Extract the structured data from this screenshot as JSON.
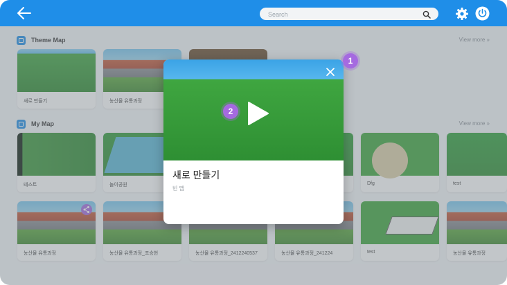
{
  "search": {
    "placeholder": "Search"
  },
  "theme_map": {
    "title": "Theme Map",
    "view_more": "View more »",
    "cards": [
      {
        "label": "새로 만들기",
        "thumb": "green-field"
      },
      {
        "label": "농산물 유통과정",
        "thumb": "farm"
      },
      {
        "label": "",
        "thumb": "dirt-field"
      }
    ]
  },
  "my_map": {
    "title": "My Map",
    "view_more": "View more »",
    "row1": [
      {
        "label": "테스트",
        "thumb": "dark-field"
      },
      {
        "label": "놀이공원",
        "thumb": "park"
      },
      {
        "label": "",
        "thumb": "green-field"
      },
      {
        "label": "",
        "thumb": "green-field"
      },
      {
        "label": "",
        "thumb": "green-field"
      },
      {
        "label": "Dfg",
        "thumb": "disc-field"
      },
      {
        "label": "test",
        "thumb": "green-field"
      }
    ],
    "row2": [
      {
        "label": "농산물 유통과정",
        "thumb": "farm"
      },
      {
        "label": "농산물 유통과정_조승현",
        "thumb": "farm"
      },
      {
        "label": "농산물 유통과정_2412240537",
        "thumb": "farm"
      },
      {
        "label": "농산물 유통과정_241224",
        "thumb": "farm"
      },
      {
        "label": "test",
        "thumb": "plane-field"
      },
      {
        "label": "농산물 유통과정",
        "thumb": "farm"
      }
    ]
  },
  "modal": {
    "title": "새로 만들기",
    "subtitle": "빈 맵"
  },
  "badges": {
    "one": "1",
    "two": "2"
  },
  "colors": {
    "topbar": "#1f8ee8",
    "badge": "#a56ae0",
    "accent": "#1f8ee8"
  },
  "icons": {
    "back": "arrow-left-icon",
    "search": "search-icon",
    "settings": "gear-icon",
    "power": "power-icon",
    "close": "close-icon",
    "play": "play-icon",
    "share": "share-icon"
  }
}
